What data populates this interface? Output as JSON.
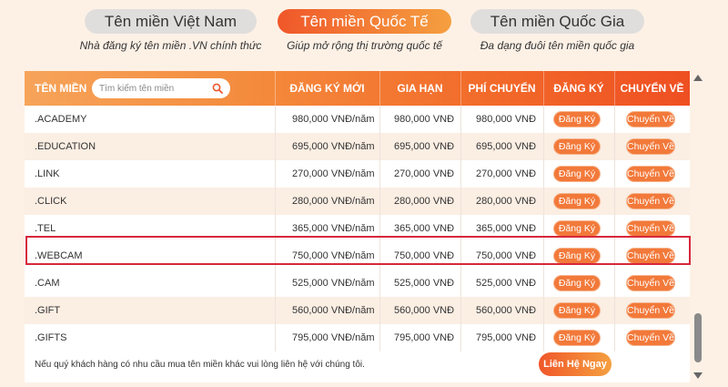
{
  "tabs": [
    {
      "label": "Tên miền Việt Nam",
      "subtitle": "Nhà đăng ký tên miền .VN chính thức"
    },
    {
      "label": "Tên miền Quốc Tế",
      "subtitle": "Giúp mở rộng thị trường quốc tế"
    },
    {
      "label": "Tên miền Quốc Gia",
      "subtitle": "Đa dạng đuôi tên miền quốc gia"
    }
  ],
  "table": {
    "headers": {
      "domain": "TÊN MIỀN",
      "register_price": "ĐĂNG KÝ MỚI",
      "renew_price": "GIA HẠN",
      "transfer_fee": "PHÍ CHUYỂN",
      "register": "ĐĂNG KÝ",
      "transfer": "CHUYỂN VỀ"
    },
    "search_placeholder": "Tìm kiếm tên miền",
    "rows": [
      {
        "domain": ".ACADEMY",
        "register": "980,000 VNĐ/năm",
        "renew": "980,000 VNĐ",
        "transfer": "980,000 VNĐ",
        "btn_register": "Đăng Ký",
        "btn_transfer": "Chuyển Về"
      },
      {
        "domain": ".EDUCATION",
        "register": "695,000 VNĐ/năm",
        "renew": "695,000 VNĐ",
        "transfer": "695,000 VNĐ",
        "btn_register": "Đăng Ký",
        "btn_transfer": "Chuyển Về"
      },
      {
        "domain": ".LINK",
        "register": "270,000 VNĐ/năm",
        "renew": "270,000 VNĐ",
        "transfer": "270,000 VNĐ",
        "btn_register": "Đăng Ký",
        "btn_transfer": "Chuyển Về"
      },
      {
        "domain": ".CLICK",
        "register": "280,000 VNĐ/năm",
        "renew": "280,000 VNĐ",
        "transfer": "280,000 VNĐ",
        "btn_register": "Đăng Ký",
        "btn_transfer": "Chuyển Về"
      },
      {
        "domain": ".TEL",
        "register": "365,000 VNĐ/năm",
        "renew": "365,000 VNĐ",
        "transfer": "365,000 VNĐ",
        "btn_register": "Đăng Ký",
        "btn_transfer": "Chuyển Về"
      },
      {
        "domain": ".WEBCAM",
        "register": "750,000 VNĐ/năm",
        "renew": "750,000 VNĐ",
        "transfer": "750,000 VNĐ",
        "btn_register": "Đăng Ký",
        "btn_transfer": "Chuyển Về"
      },
      {
        "domain": ".CAM",
        "register": "525,000 VNĐ/năm",
        "renew": "525,000 VNĐ",
        "transfer": "525,000 VNĐ",
        "btn_register": "Đăng Ký",
        "btn_transfer": "Chuyển Về"
      },
      {
        "domain": ".GIFT",
        "register": "560,000 VNĐ/năm",
        "renew": "560,000 VNĐ",
        "transfer": "560,000 VNĐ",
        "btn_register": "Đăng Ký",
        "btn_transfer": "Chuyển Về"
      },
      {
        "domain": ".GIFTS",
        "register": "795,000 VNĐ/năm",
        "renew": "795,000 VNĐ",
        "transfer": "795,000 VNĐ",
        "btn_register": "Đăng Ký",
        "btn_transfer": "Chuyển Về"
      }
    ],
    "highlighted_row": ".WEBCAM"
  },
  "footer": {
    "note": "Nếu quý khách hàng có nhu cầu mua tên miền khác vui lòng liên hệ với chúng tôi.",
    "contact_button": "Liên Hệ Ngay"
  },
  "colors": {
    "accent": "#f0572a",
    "accent_light": "#f5a040",
    "highlight_border": "#d7283a"
  }
}
